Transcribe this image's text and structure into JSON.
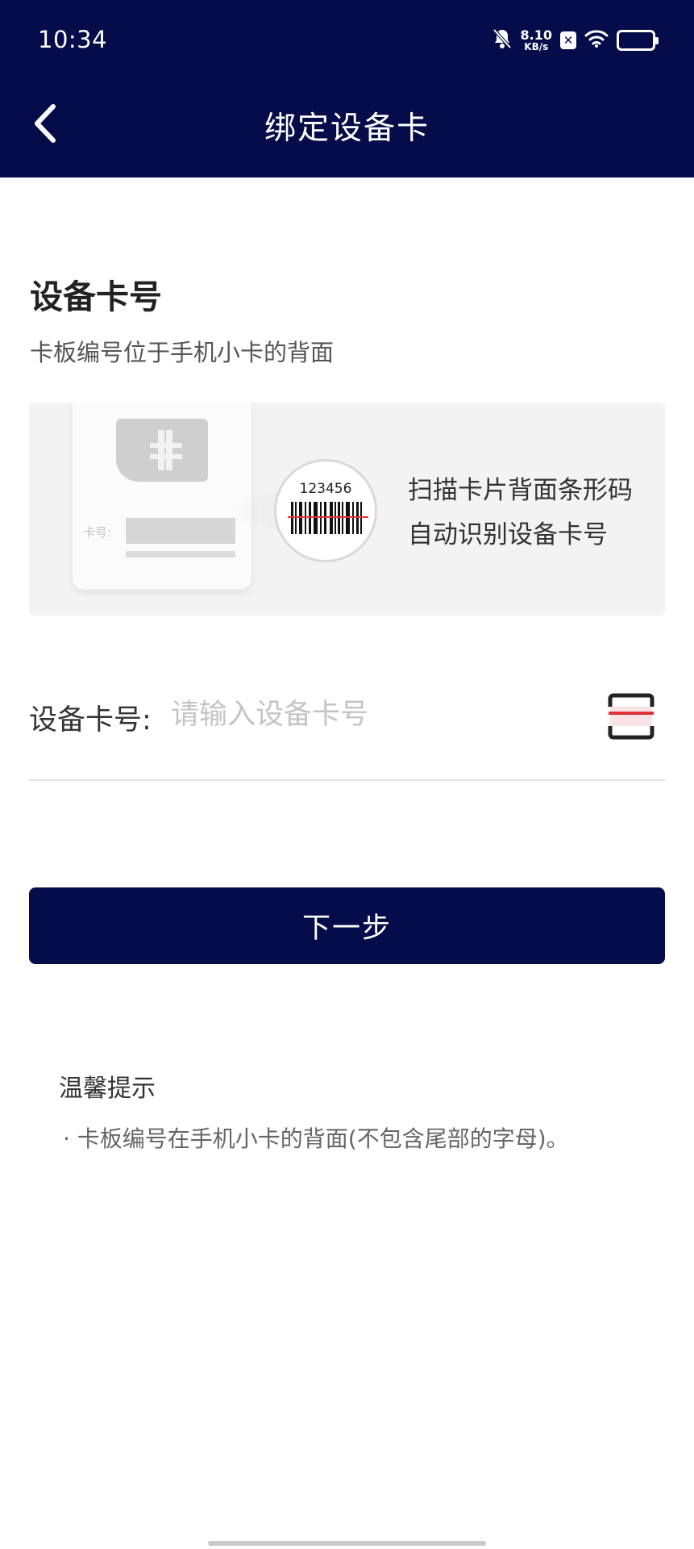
{
  "status_bar": {
    "time": "10:34",
    "net_speed_value": "8.10",
    "net_speed_unit": "KB/s",
    "x_badge": "✕",
    "icons": [
      "bell-off-icon",
      "x-badge-icon",
      "wifi-icon",
      "battery-icon"
    ]
  },
  "nav": {
    "title": "绑定设备卡",
    "back_icon": "chevron-left-icon"
  },
  "section": {
    "title": "设备卡号",
    "description": "卡板编号位于手机小卡的背面"
  },
  "banner": {
    "card_label": "卡号:",
    "barcode_number": "123456",
    "line1": "扫描卡片背面条形码",
    "line2": "自动识别设备卡号"
  },
  "form": {
    "card_label": "设备卡号:",
    "card_value": "",
    "card_placeholder": "请输入设备卡号",
    "scan_icon": "scan-icon"
  },
  "actions": {
    "next_label": "下一步"
  },
  "tips": {
    "title": "温馨提示",
    "items": [
      "· 卡板编号在手机小卡的背面(不包含尾部的字母)。"
    ]
  },
  "colors": {
    "primary": "#050c4a",
    "scan_accent": "#e0303a"
  }
}
